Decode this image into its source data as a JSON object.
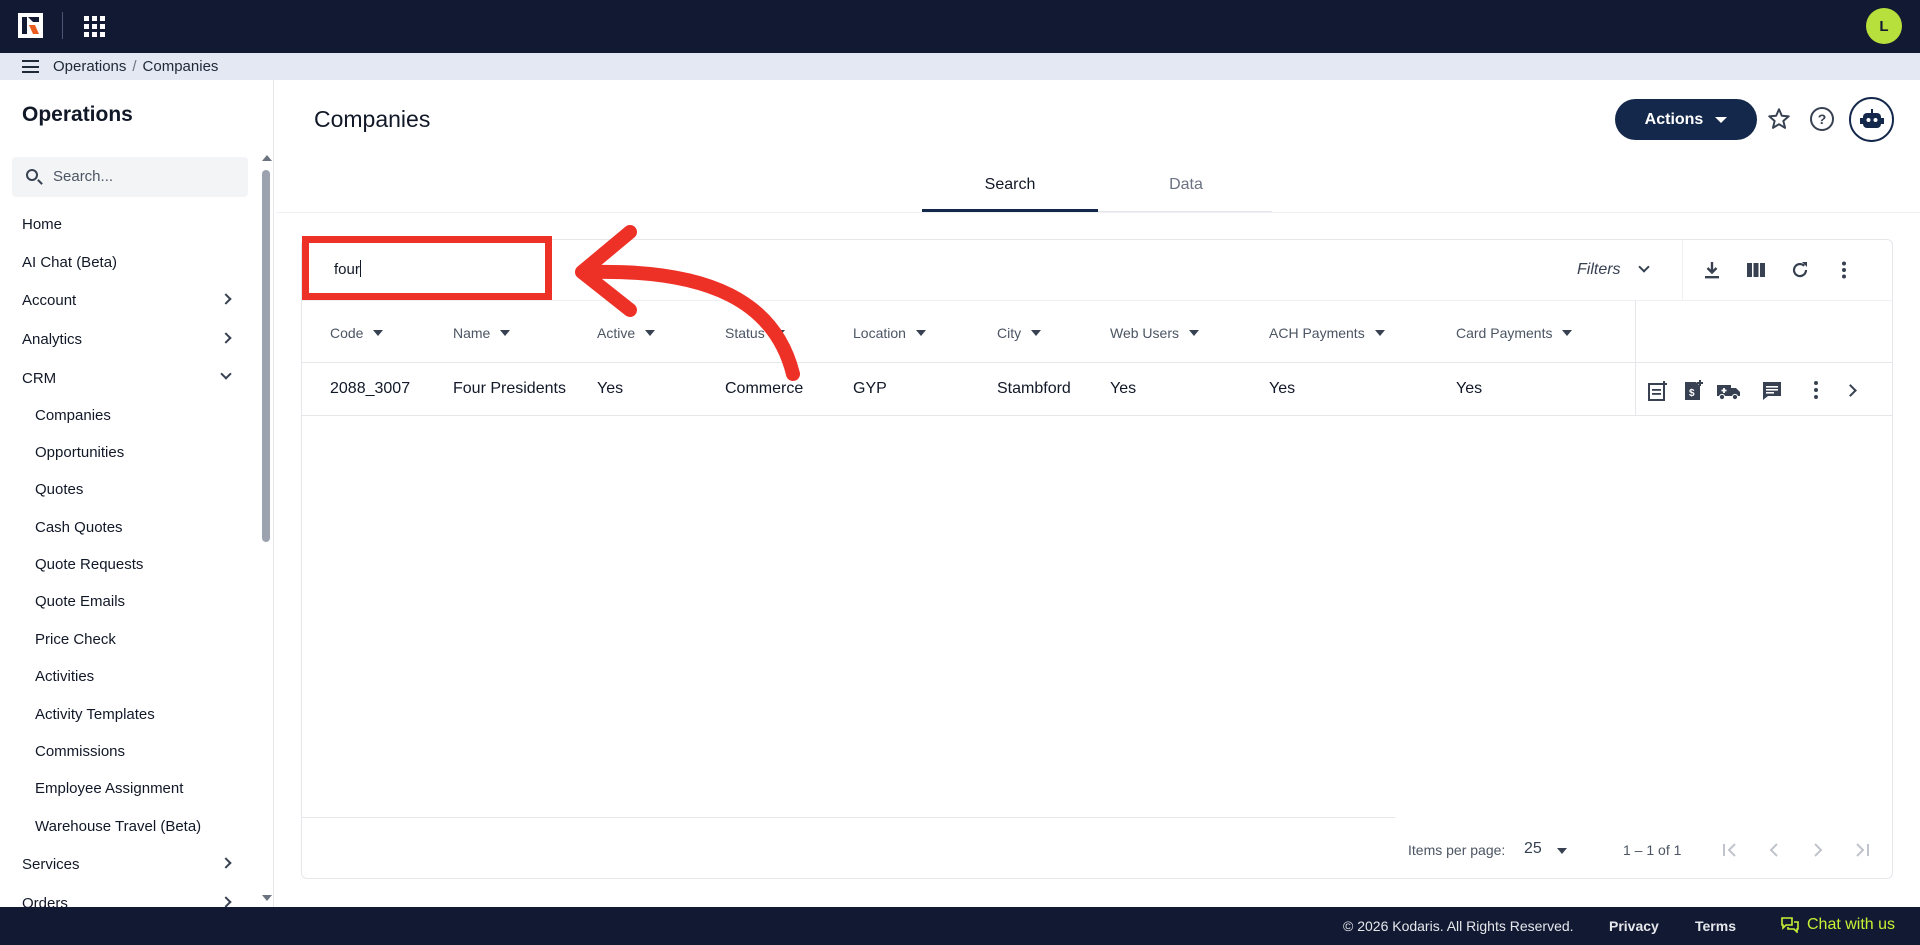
{
  "header": {
    "avatar_initial": "L"
  },
  "breadcrumb": {
    "items": [
      "Operations",
      "Companies"
    ],
    "separator": "/"
  },
  "sidebar": {
    "title": "Operations",
    "search_placeholder": "Search...",
    "items": [
      {
        "label": "Home"
      },
      {
        "label": "AI Chat (Beta)"
      },
      {
        "label": "Account",
        "expandable": true
      },
      {
        "label": "Analytics",
        "expandable": true
      },
      {
        "label": "CRM",
        "expanded": true
      }
    ],
    "crm_children": [
      "Companies",
      "Opportunities",
      "Quotes",
      "Cash Quotes",
      "Quote Requests",
      "Quote Emails",
      "Price Check",
      "Activities",
      "Activity Templates",
      "Commissions",
      "Employee Assignment",
      "Warehouse Travel (Beta)"
    ],
    "after_items": [
      {
        "label": "Services",
        "expandable": true
      },
      {
        "label": "Orders",
        "expandable": true
      }
    ]
  },
  "main": {
    "title": "Companies",
    "actions_label": "Actions",
    "tabs": [
      {
        "label": "Search",
        "active": true
      },
      {
        "label": "Data",
        "active": false
      }
    ],
    "search_value": "four",
    "filters_label": "Filters",
    "columns": [
      "Code",
      "Name",
      "Active",
      "Status",
      "Location",
      "City",
      "Web Users",
      "ACH Payments",
      "Card Payments"
    ],
    "rows": [
      {
        "code": "2088_3007",
        "name": "Four Presidents",
        "active": "Yes",
        "status": "Commerce",
        "location": "GYP",
        "city": "Stambford",
        "web_users": "Yes",
        "ach": "Yes",
        "card": "Yes"
      }
    ],
    "pager": {
      "items_per_page_label": "Items per page:",
      "page_size": "25",
      "range": "1 – 1 of 1"
    }
  },
  "footer": {
    "copyright": "© 2026 Kodaris. All Rights Reserved.",
    "privacy": "Privacy",
    "terms": "Terms",
    "chat": "Chat with us"
  },
  "colors": {
    "topbar": "#121a33",
    "accent_navy": "#14284b",
    "avatar": "#b8e03c",
    "annotation_red": "#ee3127",
    "chat_green": "#c6f135"
  }
}
